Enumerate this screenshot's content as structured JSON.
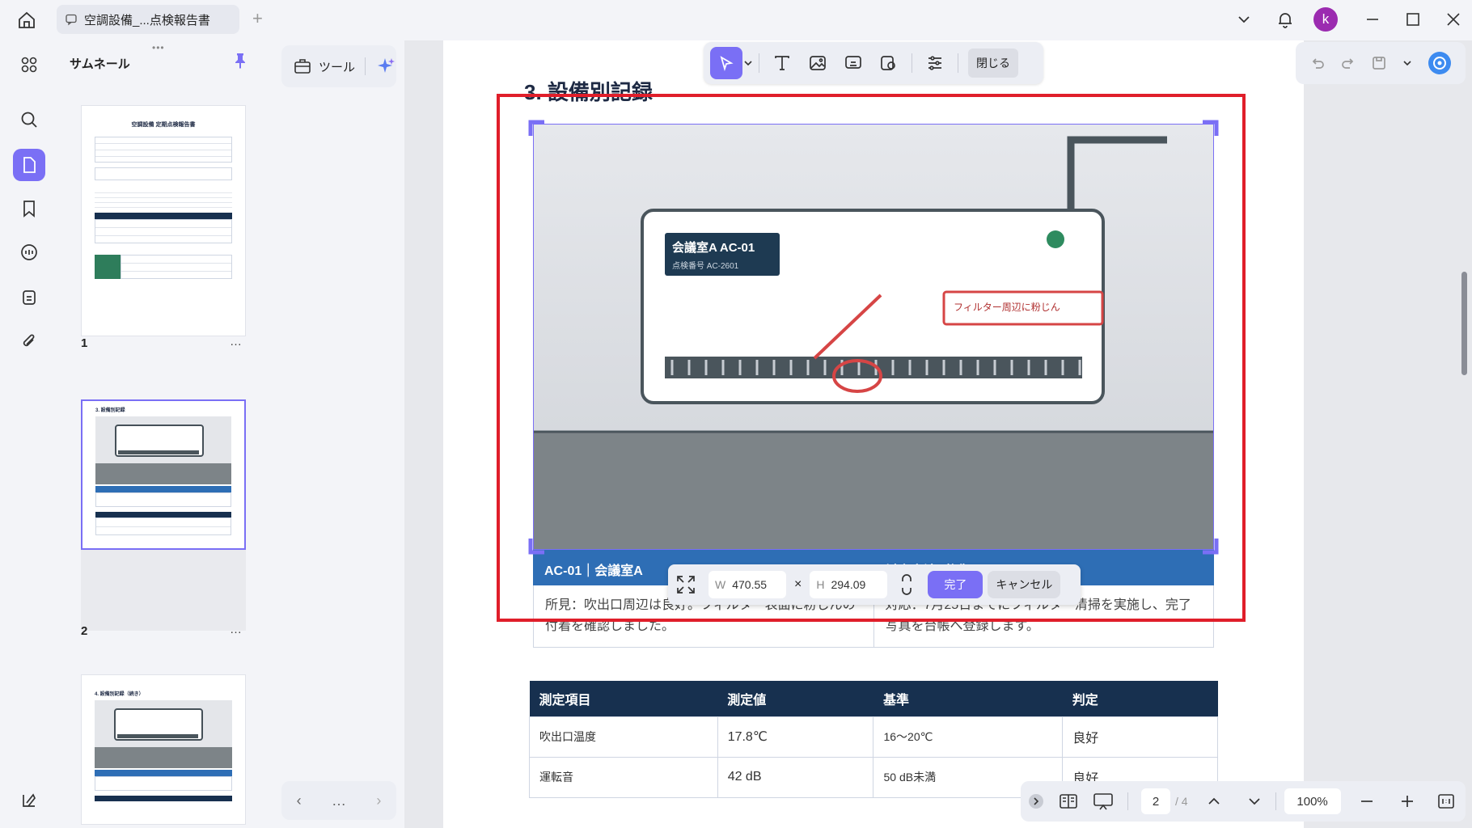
{
  "titlebar": {
    "tab_title": "空調設備_...点検報告書",
    "avatar_letter": "k"
  },
  "sidebar": {
    "items": [
      {
        "icon": "grid-icon"
      },
      {
        "icon": "search-icon"
      },
      {
        "icon": "pages-icon"
      },
      {
        "icon": "bookmark-icon"
      },
      {
        "icon": "comment-icon"
      },
      {
        "icon": "document-icon"
      },
      {
        "icon": "paperclip-icon"
      }
    ]
  },
  "thumbnails": {
    "title": "サムネール",
    "pages": [
      {
        "number": "1",
        "header": "空調設備 定期点検報告書",
        "selected": false
      },
      {
        "number": "2",
        "header": "3. 設備別記録",
        "selected": true
      },
      {
        "number": "",
        "header": "4. 設備別記録（続き）",
        "selected": false
      }
    ],
    "more": "…"
  },
  "tools": {
    "label": "ツール"
  },
  "edit_toolbar": {
    "close_label": "閉じる"
  },
  "document": {
    "section_heading": "3. 設備別記録",
    "figure": {
      "unit_name": "会議室A AC-01",
      "unit_sub": "点検番号 AC-2601",
      "callout": "フィルター周辺に粉じん"
    },
    "findings": {
      "left_header": "AC-01｜会議室A",
      "right_header": "対応方法（例）",
      "left_text": "所見：吹出口周辺は良好。フィルター表面に粉じんの付着を確認しました。",
      "right_text": "対応：7月25日までにフィルター清掃を実施し、完了写真を台帳へ登録します。"
    },
    "measurements": {
      "headers": [
        "測定項目",
        "測定値",
        "基準",
        "判定"
      ],
      "rows": [
        [
          "吹出口温度",
          "17.8℃",
          "16～20℃",
          "良好"
        ],
        [
          "運転音",
          "42 dB",
          "50 dB未満",
          "良好"
        ]
      ]
    }
  },
  "resize_bar": {
    "w_label": "W",
    "w_value": "470.55",
    "times": "×",
    "h_label": "H",
    "h_value": "294.09",
    "done_label": "完了",
    "cancel_label": "キャンセル"
  },
  "page_nav": {
    "current_page": "2",
    "total_pages": "/ 4",
    "zoom": "100%"
  },
  "colors": {
    "accent": "#7a6ff5",
    "selection_red": "#e01e2a",
    "table_header": "#17304f",
    "findings_header": "#2e6eb5"
  }
}
